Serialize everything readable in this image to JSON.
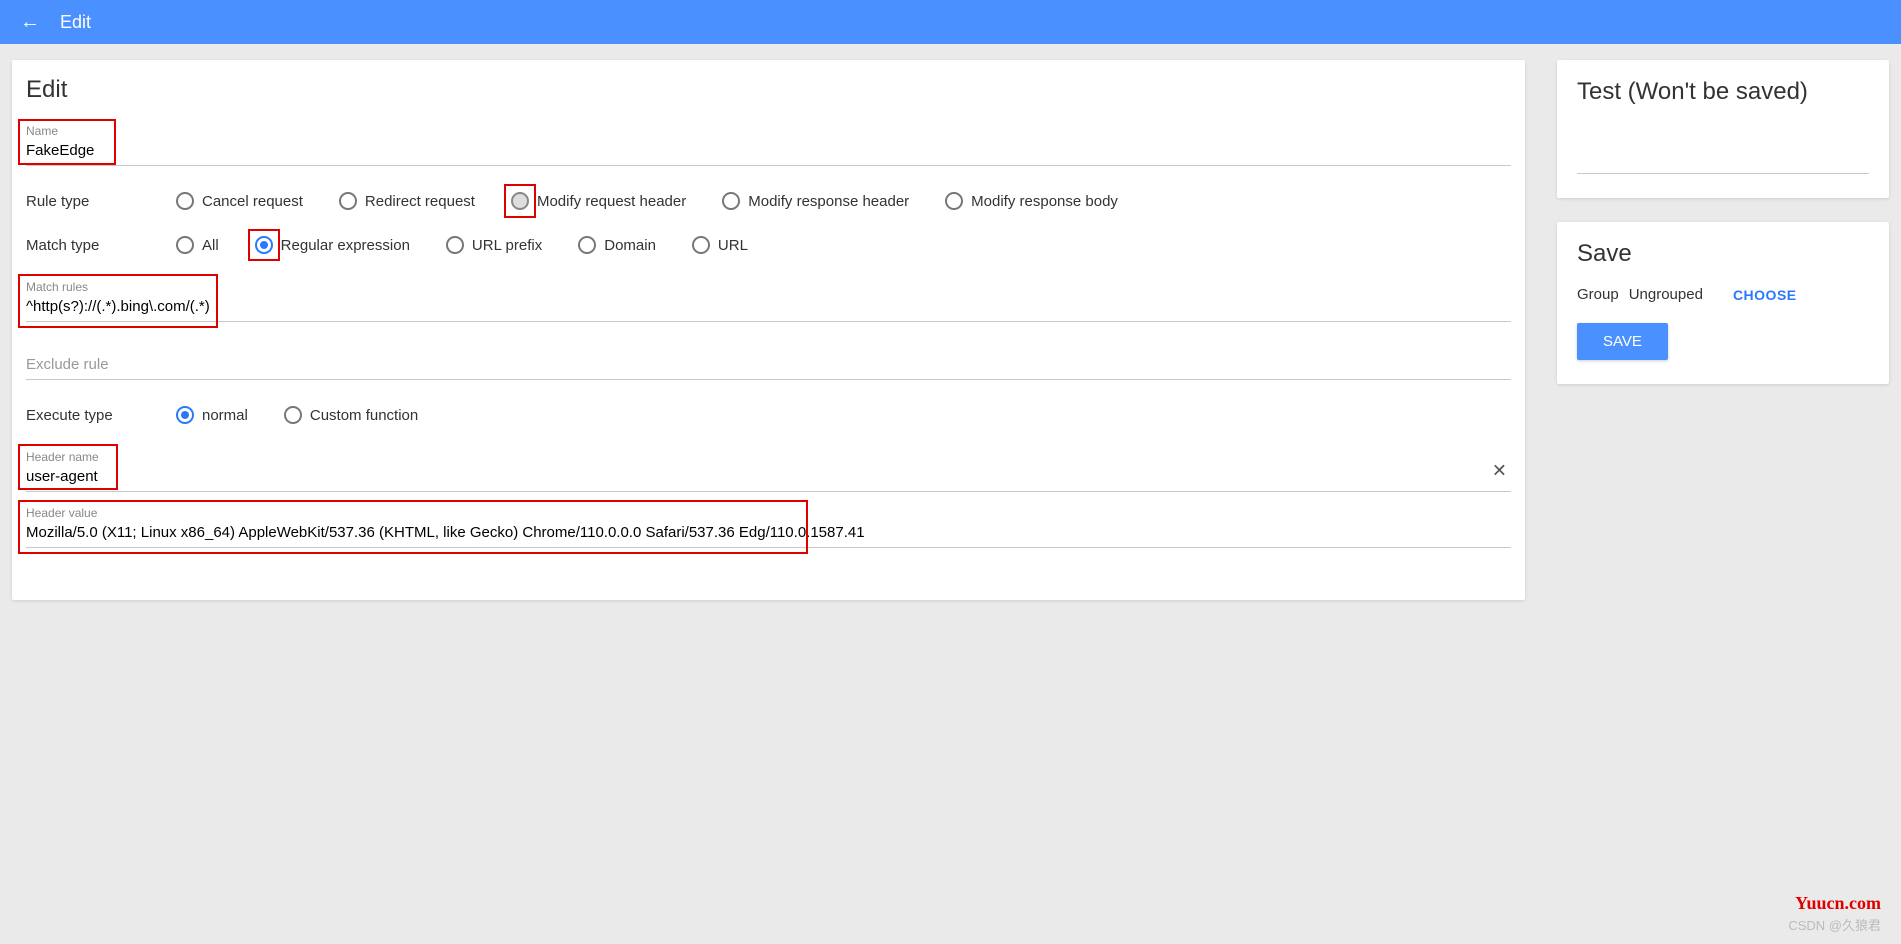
{
  "topbar": {
    "title": "Edit"
  },
  "main": {
    "heading": "Edit",
    "name": {
      "label": "Name",
      "value": "FakeEdge"
    },
    "ruleType": {
      "label": "Rule type",
      "options": [
        "Cancel request",
        "Redirect request",
        "Modify request header",
        "Modify response header",
        "Modify response body"
      ],
      "selected": 2
    },
    "matchType": {
      "label": "Match type",
      "options": [
        "All",
        "Regular expression",
        "URL prefix",
        "Domain",
        "URL"
      ],
      "selected": 1
    },
    "matchRules": {
      "label": "Match rules",
      "value": "^http(s?)://(.*).bing\\.com/(.*)"
    },
    "excludeRule": {
      "placeholder": "Exclude rule",
      "value": ""
    },
    "executeType": {
      "label": "Execute type",
      "options": [
        "normal",
        "Custom function"
      ],
      "selected": 0
    },
    "headerName": {
      "label": "Header name",
      "value": "user-agent"
    },
    "headerValue": {
      "label": "Header value",
      "value": "Mozilla/5.0 (X11; Linux x86_64) AppleWebKit/537.36 (KHTML, like Gecko) Chrome/110.0.0.0 Safari/537.36 Edg/110.0.1587.41"
    }
  },
  "test": {
    "heading": "Test (Won't be saved)"
  },
  "save": {
    "heading": "Save",
    "groupLabel": "Group",
    "groupValue": "Ungrouped",
    "chooseLabel": "CHOOSE",
    "saveLabel": "SAVE"
  },
  "watermark1": "Yuucn.com",
  "watermark2": "CSDN @久狼君"
}
